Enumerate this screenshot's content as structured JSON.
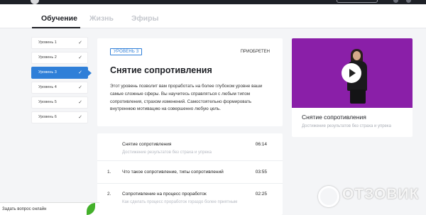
{
  "tabs": [
    {
      "label": "Обучение"
    },
    {
      "label": "Жизнь"
    },
    {
      "label": "Эфиры"
    }
  ],
  "levels": [
    {
      "label": "Уровень 1"
    },
    {
      "label": "Уровень 2"
    },
    {
      "label": "Уровень 3"
    },
    {
      "label": "Уровень 4"
    },
    {
      "label": "Уровень 5"
    },
    {
      "label": "Уровень 6"
    }
  ],
  "level_check_icon": "✓",
  "card": {
    "badge": "УРОВЕНЬ 3",
    "status": "ПРИОБРЕТЕН",
    "title": "Снятие сопротивления",
    "description": "Этот уровень позволит вам проработать на более глубоком уровне ваши самые сложные сферы. Вы научитесь справляться с любым типом сопротивления, страхом изменений. Самостоятельно формировать внутреннюю мотивацию на совершенно любую цель."
  },
  "video": {
    "title": "Снятие сопротивления",
    "subtitle": "Достижение результатов без страха и упрека"
  },
  "lessons": [
    {
      "num": "",
      "title": "Снятие сопротивления",
      "time": "06:14",
      "subtitle": "Достижение результатов без страха и упрека"
    },
    {
      "num": "1.",
      "title": "Что такое сопротивление, типы сопротивлений",
      "time": "03:55",
      "subtitle": ""
    },
    {
      "num": "2.",
      "title": "Сопротивление на процесс проработок",
      "time": "02:25",
      "subtitle": "Как сделать процесс проработок гораздо более приятным"
    }
  ],
  "chat": {
    "label": "Задать вопрос онлайн"
  },
  "watermark": "ОТЗОВИК",
  "colors": {
    "accent": "#2f7fd8",
    "video_bg": "#8a1fa8",
    "chat_leaf": "#43b02a"
  }
}
